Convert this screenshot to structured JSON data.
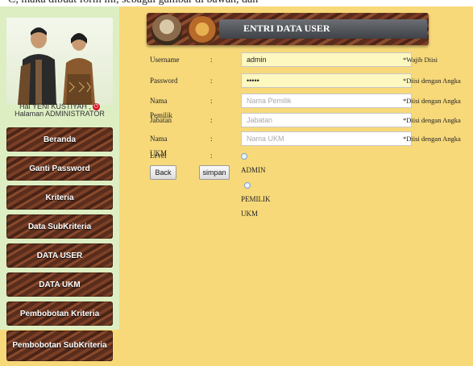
{
  "page": {
    "top_text": "C, maka dibuat form ini, sebagai gambar di bawah, dan"
  },
  "sidebar": {
    "greeting": "Hai YENI KUSTIYAH ,",
    "role": "Halaman ADMINISTRATOR",
    "items": [
      {
        "label": "Beranda"
      },
      {
        "label": "Ganti Password"
      },
      {
        "label": "Kriteria"
      },
      {
        "label": "Data SubKriteria"
      },
      {
        "label": "DATA USER"
      },
      {
        "label": "DATA UKM"
      },
      {
        "label": "Pembobotan Kriteria"
      },
      {
        "label": "Pembobotan SubKriteria"
      }
    ]
  },
  "header": {
    "title": "ENTRI DATA USER"
  },
  "form": {
    "colon": ":",
    "username": {
      "label": "Username",
      "value": "admin",
      "note": "*Wajib Diisi"
    },
    "password": {
      "label": "Password",
      "value": "•••••",
      "note": "*Diisi dengan Angka"
    },
    "nama_pemilik": {
      "label": "Nama Pemilik",
      "placeholder": "Nama Pemilik",
      "note": "*Diisi dengan Angka"
    },
    "jabatan": {
      "label": "Jabatan",
      "placeholder": "Jabatan",
      "note": "*Diisi dengan Angka"
    },
    "nama_ukm": {
      "label": "Nama UKM",
      "placeholder": "Nama UKM",
      "note": "*Diisi dengan Angka"
    },
    "level": {
      "label": "Level",
      "options": [
        "ADMIN",
        "PEMILIK UKM"
      ]
    }
  },
  "buttons": {
    "back": "Back",
    "save": "simpan"
  }
}
